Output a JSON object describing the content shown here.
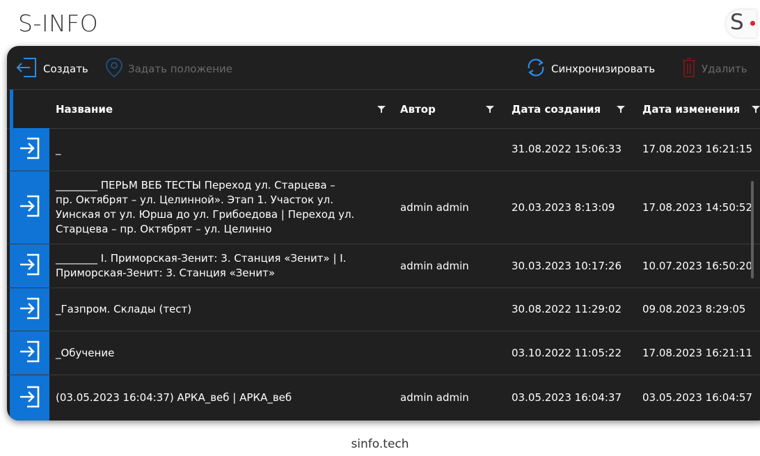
{
  "app": {
    "title": "S-INFO",
    "logo_letter": "S"
  },
  "toolbar": {
    "create_label": "Создать",
    "set_position_label": "Задать положение",
    "sync_label": "Синхронизировать",
    "delete_label": "Удалить"
  },
  "table": {
    "columns": [
      "Название",
      "Автор",
      "Дата создания",
      "Дата изменения"
    ],
    "rows": [
      {
        "name_lines": [
          "_"
        ],
        "author": "",
        "created": "31.08.2022 15:06:33",
        "modified": "17.08.2023 16:21:15"
      },
      {
        "name_lines": [
          "________ ПЕРЬМ ВЕБ ТЕСТЫ Переход ул. Старцева –",
          "пр. Октябрят – ул. Целинной». Этап 1. Участок ул.",
          "Уинская от ул. Юрша до ул. Грибоедова | Переход ул.",
          "Старцева – пр. Октябрят – ул. Целинно"
        ],
        "author": "admin admin",
        "created": "20.03.2023 8:13:09",
        "modified": "17.08.2023 14:50:52"
      },
      {
        "name_lines": [
          "________ I. Приморская-Зенит: 3. Станция «Зенит» | I.",
          "Приморская-Зенит: 3. Станция «Зенит»"
        ],
        "author": "admin admin",
        "created": "30.03.2023 10:17:26",
        "modified": "10.07.2023 16:50:20"
      },
      {
        "name_lines": [
          "_Газпром. Склады (тест)"
        ],
        "author": "",
        "created": "30.08.2022 11:29:02",
        "modified": "09.08.2023 8:29:05"
      },
      {
        "name_lines": [
          "_Обучение"
        ],
        "author": "",
        "created": "03.10.2022 11:05:22",
        "modified": "17.08.2023 16:21:11"
      },
      {
        "name_lines": [
          "(03.05.2023 16:04:37) АРКА_веб | АРКА_веб"
        ],
        "author": "admin admin",
        "created": "03.05.2023 16:04:37",
        "modified": "03.05.2023 16:04:57"
      }
    ]
  },
  "footer": {
    "text": "sinfo.tech"
  },
  "colors": {
    "accent": "#0f74d6",
    "background": "#202020",
    "brand_dot": "#e32229"
  }
}
